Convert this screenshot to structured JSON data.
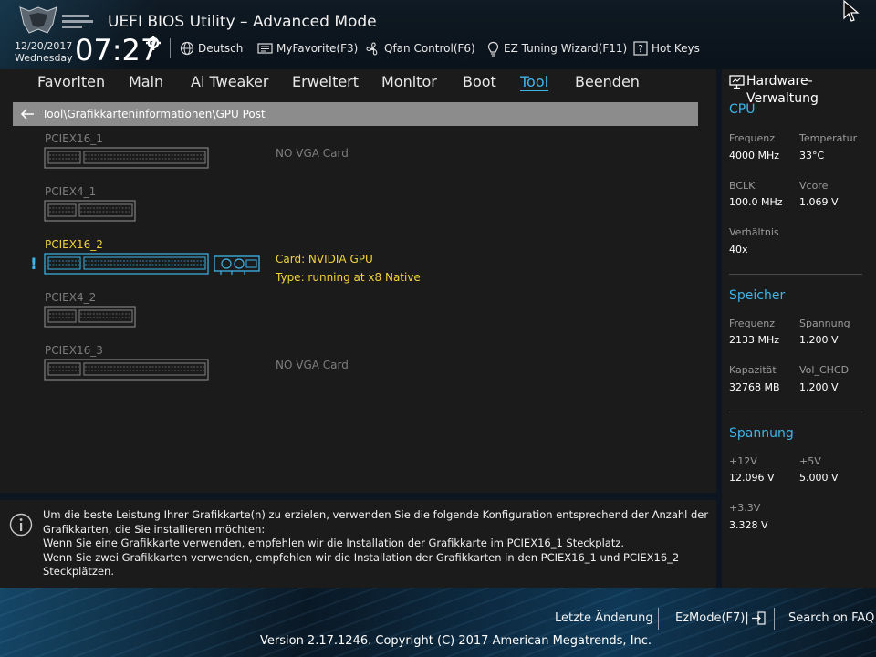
{
  "header": {
    "app_title": "UEFI BIOS Utility – Advanced Mode",
    "date": "12/20/2017",
    "weekday": "Wednesday",
    "time": "07:27",
    "items": [
      {
        "label": "Deutsch",
        "icon": "globe-icon"
      },
      {
        "label": "MyFavorite(F3)",
        "icon": "favorite-icon"
      },
      {
        "label": "Qfan Control(F6)",
        "icon": "fan-icon"
      },
      {
        "label": "EZ Tuning Wizard(F11)",
        "icon": "bulb-icon"
      },
      {
        "label": "Hot Keys",
        "icon": "question-icon"
      }
    ]
  },
  "nav": {
    "tabs": [
      "Favoriten",
      "Main",
      "Ai Tweaker",
      "Erweitert",
      "Monitor",
      "Boot",
      "Tool",
      "Beenden"
    ],
    "active": "Tool"
  },
  "breadcrumb": "Tool\\Grafikkarteninformationen\\GPU Post",
  "slots": [
    {
      "name": "PCIEX16_1",
      "status": "NO VGA Card"
    },
    {
      "name": "PCIEX4_1",
      "status": ""
    },
    {
      "name": "PCIEX16_2",
      "card": "Card: NVIDIA GPU",
      "type": "Type: running at x8 Native"
    },
    {
      "name": "PCIEX4_2",
      "status": ""
    },
    {
      "name": "PCIEX16_3",
      "status": "NO VGA Card"
    }
  ],
  "excl": "!",
  "info": {
    "line1": "Um die beste Leistung Ihrer Grafikkarte(n) zu erzielen, verwenden Sie die folgende Konfiguration entsprechend der Anzahl der",
    "line2": "Grafikkarten, die Sie installieren möchten:",
    "line3": "Wenn Sie eine Grafikkarte verwenden, empfehlen wir die Installation der Grafikkarte im PCIEX16_1 Steckplatz.",
    "line4": "Wenn Sie zwei Grafikkarten verwenden, empfehlen wir die Installation der Grafikkarten in den PCIEX16_1 und PCIEX16_2 Steckplätzen."
  },
  "hardware": {
    "title": "Hardware-Verwaltung",
    "cpu": {
      "heading": "CPU",
      "freq_label": "Frequenz",
      "freq_value": "4000 MHz",
      "temp_label": "Temperatur",
      "temp_value": "33°C",
      "bclk_label": "BCLK",
      "bclk_value": "100.0 MHz",
      "vcore_label": "Vcore",
      "vcore_value": "1.069 V",
      "ratio_label": "Verhältnis",
      "ratio_value": "40x"
    },
    "memory": {
      "heading": "Speicher",
      "freq_label": "Frequenz",
      "freq_value": "2133 MHz",
      "volt_label": "Spannung",
      "volt_value": "1.200 V",
      "cap_label": "Kapazität",
      "cap_value": "32768 MB",
      "chcd_label": "Vol_CHCD",
      "chcd_value": "1.200 V"
    },
    "voltage": {
      "heading": "Spannung",
      "v12_label": "+12V",
      "v12_value": "12.096 V",
      "v5_label": "+5V",
      "v5_value": "5.000 V",
      "v33_label": "+3.3V",
      "v33_value": "3.328 V"
    }
  },
  "footer": {
    "last_change": "Letzte Änderung",
    "ezmode": "EzMode(F7)|",
    "faq": "Search on FAQ",
    "version": "Version 2.17.1246. Copyright (C) 2017 American Megatrends, Inc."
  },
  "colors": {
    "accent": "#3fb5e8",
    "active_slot": "#f2d23a",
    "panel": "#1b1b1b"
  }
}
